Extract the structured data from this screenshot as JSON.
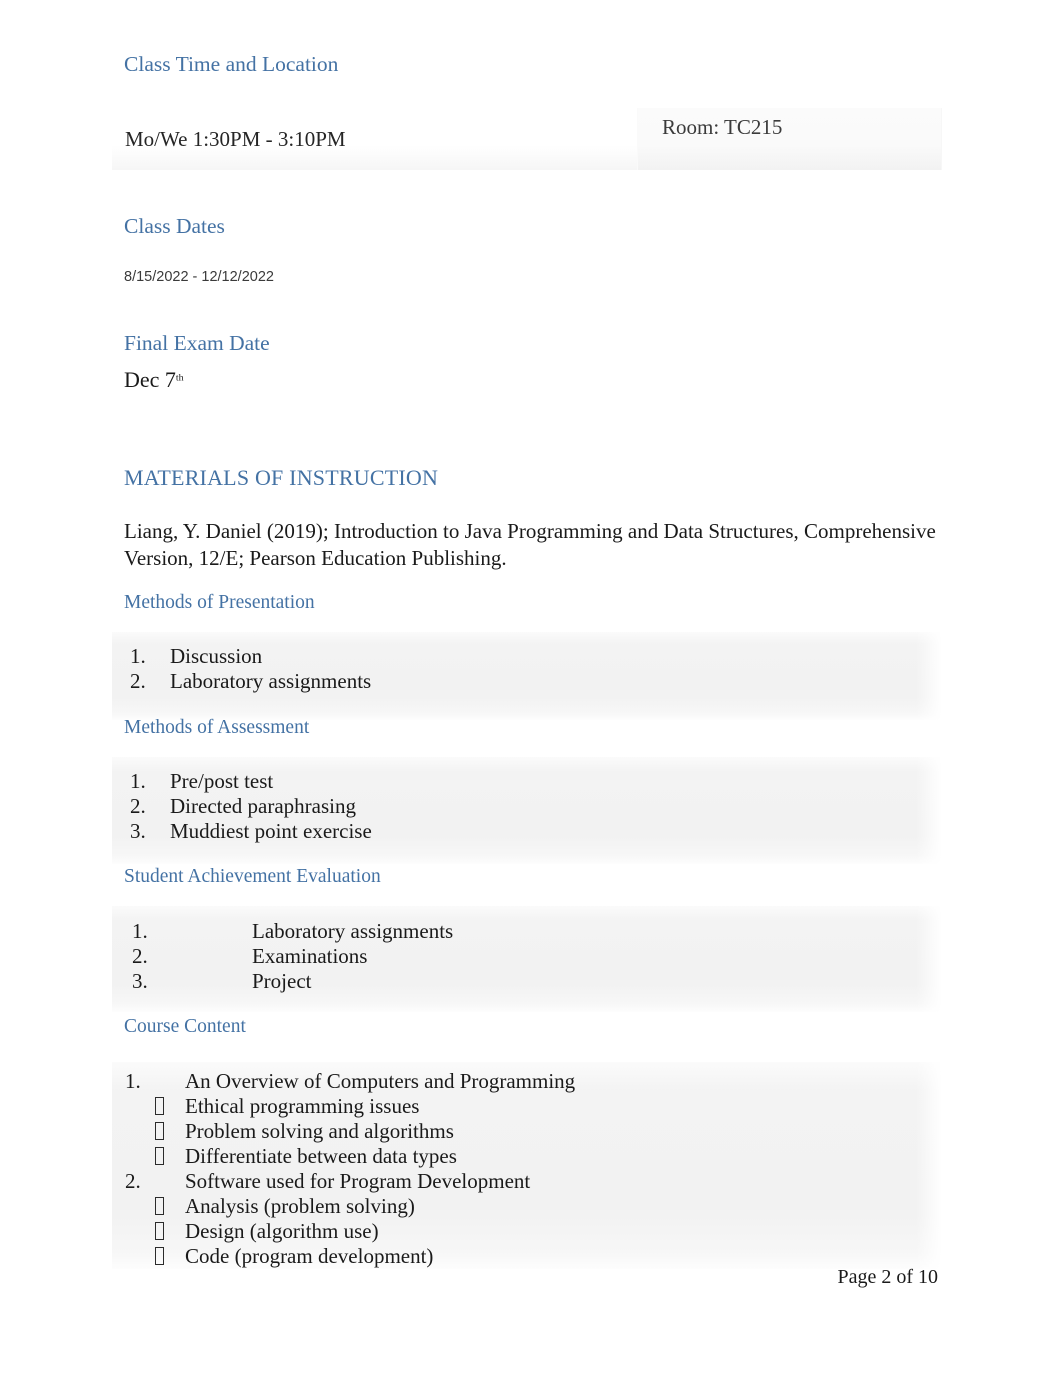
{
  "document": {
    "sections": {
      "class_time": {
        "heading": "Class Time and Location",
        "time": "Mo/We  1:30PM - 3:10PM",
        "room": "Room: TC215"
      },
      "class_dates": {
        "heading": "Class Dates",
        "range": "8/15/2022 - 12/12/2022"
      },
      "final_exam": {
        "heading": "Final Exam Date",
        "date_main": "Dec  7",
        "date_ordinal": "th"
      },
      "materials": {
        "heading": "MATERIALS OF INSTRUCTION",
        "citation": "Liang, Y. Daniel (2019); Introduction to Java Programming and Data Structures, Comprehensive Version, 12/E; Pearson Education Publishing."
      },
      "methods_presentation": {
        "heading": "Methods of Presentation",
        "items": [
          {
            "num": "1.",
            "text": "Discussion"
          },
          {
            "num": "2.",
            "text": "Laboratory assignments"
          }
        ]
      },
      "methods_assessment": {
        "heading": "Methods of Assessment",
        "items": [
          {
            "num": "1.",
            "text": "Pre/post test"
          },
          {
            "num": "2.",
            "text": "Directed paraphrasing"
          },
          {
            "num": "3.",
            "text": "Muddiest point exercise"
          }
        ]
      },
      "student_achievement": {
        "heading": "Student Achievement Evaluation",
        "items": [
          {
            "num": "1.",
            "text": "Laboratory assignments"
          },
          {
            "num": "2.",
            "text": "Examinations"
          },
          {
            "num": "3.",
            "text": "Project"
          }
        ]
      },
      "course_content": {
        "heading": "Course Content",
        "rows": [
          {
            "type": "num",
            "marker": "1.",
            "text": "An Overview of Computers and Programming"
          },
          {
            "type": "bullet",
            "marker": "",
            "text": "Ethical programming issues"
          },
          {
            "type": "bullet",
            "marker": "",
            "text": "Problem solving and algorithms"
          },
          {
            "type": "bullet",
            "marker": "",
            "text": "Differentiate between data types"
          },
          {
            "type": "num",
            "marker": "2.",
            "text": "Software used for Program Development"
          },
          {
            "type": "bullet",
            "marker": "",
            "text": "Analysis (problem solving)"
          },
          {
            "type": "bullet",
            "marker": "",
            "text": "Design (algorithm use)"
          },
          {
            "type": "bullet",
            "marker": "",
            "text": "Code (program development)"
          }
        ]
      }
    },
    "footer": {
      "page_label": "Page 2 of 10"
    },
    "colors": {
      "heading_blue": "#4472a4",
      "body_text": "#1a1a1a",
      "shade_background": "#f2f2f2"
    }
  }
}
